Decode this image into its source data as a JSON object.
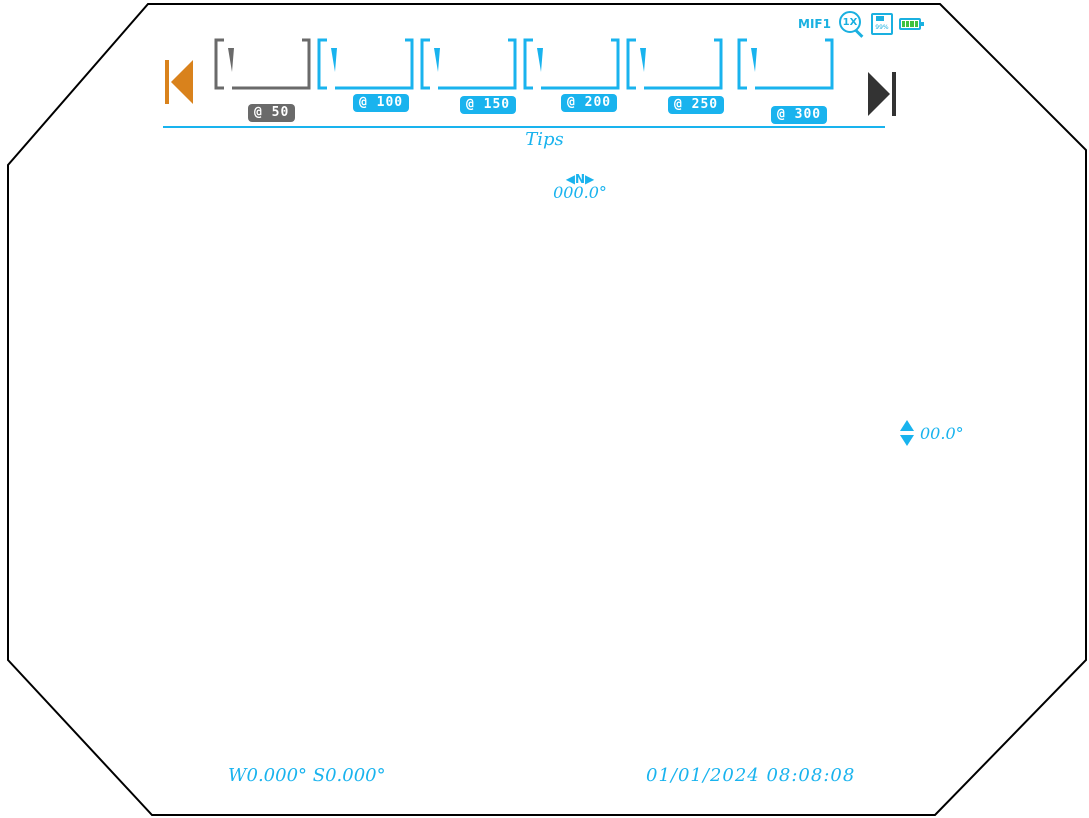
{
  "status": {
    "profile": "MIF1",
    "zoom": "1X",
    "storage": "99%",
    "battery_level_fraction": 1.0
  },
  "colors": {
    "accent": "#19b3ee",
    "inactive": "#6a6a6a",
    "prev_arrow": "#d9821c",
    "next_arrow": "#333333",
    "frame": "#000000"
  },
  "reticle_slots": [
    {
      "label": "@ 50",
      "state": "inactive"
    },
    {
      "label": "@ 100",
      "state": "active"
    },
    {
      "label": "@ 150",
      "state": "active"
    },
    {
      "label": "@ 200",
      "state": "active"
    },
    {
      "label": "@ 250",
      "state": "active"
    },
    {
      "label": "@ 300",
      "state": "selected"
    }
  ],
  "tips_label": "Tips",
  "compass": {
    "mark": "◀N▶",
    "heading": "000.0°"
  },
  "tilt": {
    "value": "00.0°"
  },
  "footer": {
    "coordinates": "W0.000° S0.000°",
    "datetime": "01/01/2024 08:08:08"
  },
  "icons": {
    "prev": "previous-arrow-icon",
    "next": "next-arrow-icon",
    "zoom": "zoom-icon",
    "storage": "sd-card-icon",
    "battery": "battery-icon",
    "tilt": "tilt-arrows-icon"
  }
}
